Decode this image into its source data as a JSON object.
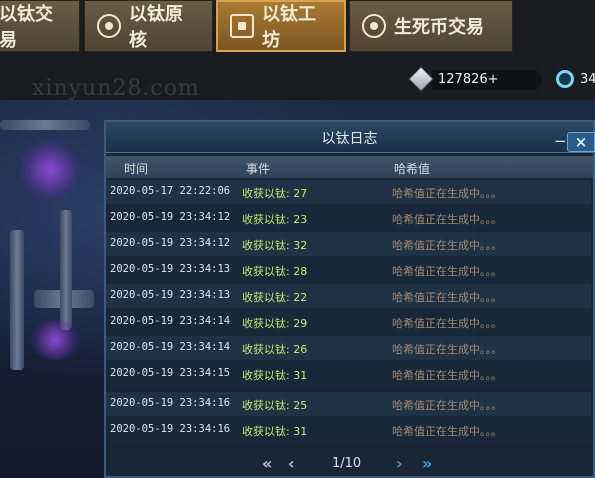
{
  "nav": {
    "tabs": [
      {
        "label": "以钛交易",
        "icon": "exchange-icon"
      },
      {
        "label": "以钛原核",
        "icon": "core-icon"
      },
      {
        "label": "以钛工坊",
        "icon": "home-icon",
        "active": true
      },
      {
        "label": "生死币交易",
        "icon": "coin-icon"
      }
    ]
  },
  "currency": {
    "cube_amount": "127826+",
    "ring_amount": "34"
  },
  "watermark": "xinyun28.com",
  "modal": {
    "title": "以钛日志",
    "close_label": "×",
    "columns": [
      "时间",
      "事件",
      "哈希值"
    ],
    "rows": [
      {
        "time": "2020-05-17 22:22:06",
        "event": "收获以钛: 27",
        "hash": "哈希值正在生成中。。。"
      },
      {
        "time": "2020-05-19 23:34:12",
        "event": "收获以钛: 23",
        "hash": "哈希值正在生成中。。。"
      },
      {
        "time": "2020-05-19 23:34:12",
        "event": "收获以钛: 32",
        "hash": "哈希值正在生成中。。。"
      },
      {
        "time": "2020-05-19 23:34:13",
        "event": "收获以钛: 28",
        "hash": "哈希值正在生成中。。。"
      },
      {
        "time": "2020-05-19 23:34:13",
        "event": "收获以钛: 22",
        "hash": "哈希值正在生成中。。。"
      },
      {
        "time": "2020-05-19 23:34:14",
        "event": "收获以钛: 29",
        "hash": "哈希值正在生成中。。。"
      },
      {
        "time": "2020-05-19 23:34:14",
        "event": "收获以钛: 26",
        "hash": "哈希值正在生成中。。。"
      },
      {
        "time": "2020-05-19 23:34:15",
        "event": "收获以钛: 31",
        "hash": "哈希值正在生成中。。。"
      },
      {
        "time": "2020-05-19 23:34:16",
        "event": "收获以钛: 25",
        "hash": "哈希值正在生成中。。。"
      },
      {
        "time": "2020-05-19 23:34:16",
        "event": "收获以钛: 31",
        "hash": "哈希值正在生成中。。。"
      }
    ],
    "pager": {
      "first": "«",
      "prev": "‹",
      "page_text": "1/10",
      "next": "›",
      "last": "»"
    }
  },
  "colors": {
    "event_text": "#c6e96a",
    "hash_text": "#a58a6d",
    "active_tab": "#a97a33",
    "pager_active": "#3c9fe6"
  }
}
